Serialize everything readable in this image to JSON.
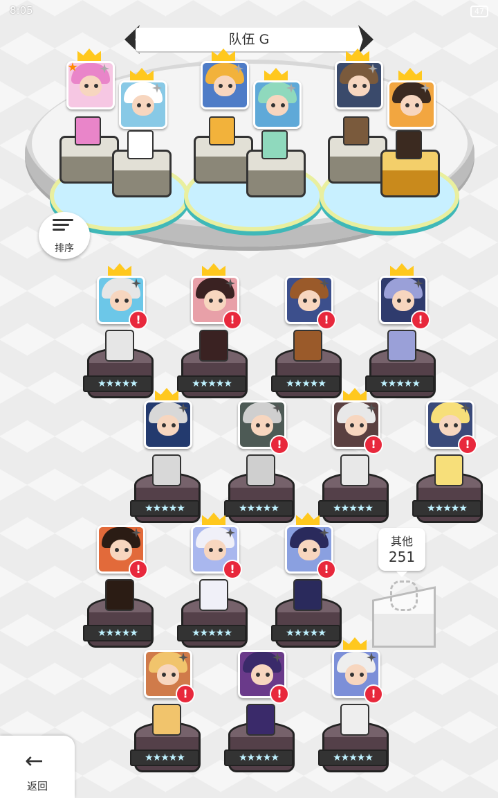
{
  "status": {
    "time": "8:05",
    "battery": "47"
  },
  "team": {
    "title": "队伍 G"
  },
  "sort": {
    "label": "排序"
  },
  "other": {
    "label": "其他",
    "count": "251"
  },
  "nav": {
    "back_label": "返回"
  },
  "icons": {
    "sort": "sort-list-icon",
    "back": "arrow-left-icon",
    "prev": "chevron-left-icon",
    "next": "chevron-right-icon",
    "alert": "exclamation-icon",
    "crown": "crown-icon",
    "sparkle": "sparkle-icon"
  },
  "colors": {
    "alert": "#e8283c",
    "crown": "#ffc81e",
    "pedestal": "#76626b"
  },
  "team_members": [
    {
      "id": "m1",
      "hair": "#e985c9",
      "bg": "#f6c7e3",
      "leader_star": true
    },
    {
      "id": "m2",
      "hair": "#ffffff",
      "bg": "#88c9e6",
      "leader_star": false
    },
    {
      "id": "m3",
      "hair": "#f2b23b",
      "bg": "#4e7cc7",
      "leader_star": false
    },
    {
      "id": "m4",
      "hair": "#8fd9bd",
      "bg": "#5fa9d8",
      "leader_star": false
    },
    {
      "id": "m5",
      "hair": "#7a5a3c",
      "bg": "#3a4a6b",
      "leader_star": false
    },
    {
      "id": "m6",
      "hair": "#3b2a20",
      "bg": "#f2a640",
      "leader_star": false
    }
  ],
  "roster": [
    {
      "id": "r1",
      "crown": true,
      "alert": true,
      "hair": "#e6e6e6",
      "bg": "#6cc7e8",
      "stars": "★★★★★"
    },
    {
      "id": "r2",
      "crown": true,
      "alert": true,
      "hair": "#3a2222",
      "bg": "#e8a0a8",
      "stars": "★★★★★"
    },
    {
      "id": "r3",
      "crown": false,
      "alert": true,
      "hair": "#9a5a2a",
      "bg": "#3c4f8c",
      "stars": "★★★★★"
    },
    {
      "id": "r4",
      "crown": true,
      "alert": true,
      "hair": "#9aa0d8",
      "bg": "#2f3b6d",
      "stars": "★★★★★"
    },
    {
      "id": "r5",
      "crown": true,
      "alert": false,
      "hair": "#d8d8d8",
      "bg": "#233a6e",
      "stars": "★★★★★"
    },
    {
      "id": "r6",
      "crown": false,
      "alert": true,
      "hair": "#cfcfcf",
      "bg": "#4d5a55",
      "stars": "★★★★★"
    },
    {
      "id": "r7",
      "crown": true,
      "alert": true,
      "hair": "#e8e8e8",
      "bg": "#5a4040",
      "stars": "★★★★★"
    },
    {
      "id": "r8",
      "crown": false,
      "alert": true,
      "hair": "#f7df7a",
      "bg": "#3a4a7a",
      "stars": "★★★★★"
    },
    {
      "id": "r9",
      "crown": false,
      "alert": true,
      "hair": "#2b1c14",
      "bg": "#e26a3a",
      "stars": "★★★★★"
    },
    {
      "id": "r10",
      "crown": true,
      "alert": true,
      "hair": "#f0f0f8",
      "bg": "#a9b7ee",
      "stars": "★★★★★"
    },
    {
      "id": "r11",
      "crown": true,
      "alert": true,
      "hair": "#2a2a5c",
      "bg": "#8aa0e0",
      "stars": "★★★★★"
    },
    {
      "id": "r12",
      "crown": false,
      "alert": true,
      "hair": "#f1c46c",
      "bg": "#d07b4a",
      "stars": "★★★★★"
    },
    {
      "id": "r13",
      "crown": false,
      "alert": true,
      "hair": "#3a2a6a",
      "bg": "#6a3a8a",
      "stars": "★★★★★"
    },
    {
      "id": "r14",
      "crown": true,
      "alert": true,
      "hair": "#eeeeee",
      "bg": "#7c8fd8",
      "stars": "★★★★★"
    }
  ]
}
